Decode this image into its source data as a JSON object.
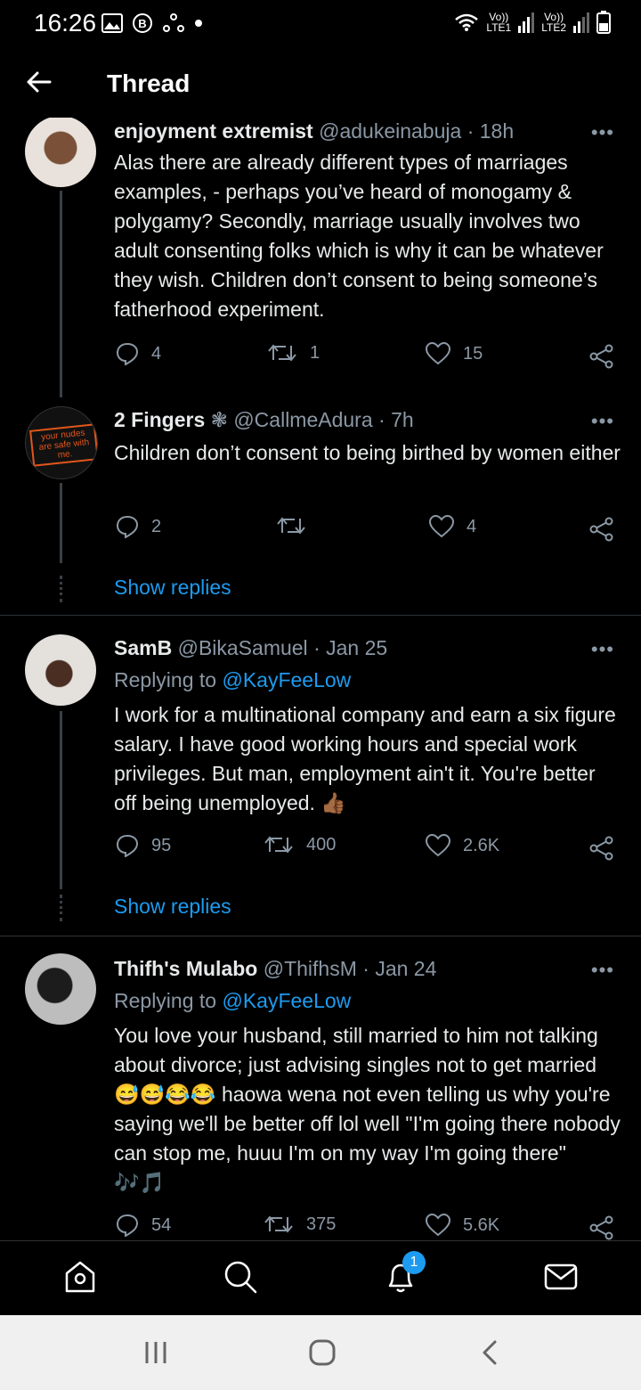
{
  "status": {
    "time": "16:26",
    "sim1": "LTE1",
    "sim2": "LTE2",
    "volte": "Vo))"
  },
  "header": {
    "title": "Thread"
  },
  "tweets": [
    {
      "name": "enjoyment extremist",
      "handle": "@adukeinabuja",
      "time": "· 18h",
      "text": "Alas there are already different types of marriages examples, - perhaps you’ve heard of monogamy & polygamy? Secondly, marriage usually involves two adult consenting folks which is why it can be whatever they wish. Children don’t  consent to being someone’s fatherhood experiment.",
      "replies": "4",
      "retweets": "1",
      "likes": "15"
    },
    {
      "name": "2 Fingers",
      "name_suffix": "❃",
      "handle": "@CallmeAdura",
      "time": "· 7h",
      "avatar_text": "your nudes are safe with me.",
      "text": "Children don’t consent to being birthed by women either",
      "replies": "2",
      "retweets": "",
      "likes": "4",
      "show_replies": "Show replies"
    },
    {
      "name": "SamB",
      "handle": "@BikaSamuel",
      "time": "· Jan 25",
      "replying_label": "Replying to",
      "replying_to": "@KayFeeLow",
      "text": "I work for a multinational company and earn a six figure salary. I have good working hours and special work privileges. But man, employment ain't it. You're better off being unemployed. 👍🏾",
      "replies": "95",
      "retweets": "400",
      "likes": "2.6K",
      "show_replies": "Show replies"
    },
    {
      "name": "Thifh's Mulabo",
      "handle": "@ThifhsM",
      "time": "· Jan 24",
      "replying_label": "Replying to",
      "replying_to": "@KayFeeLow",
      "text": "You love your husband, still married to him not talking about divorce; just advising singles not to get married 😅😅😂😂 haowa wena not even telling us why you're saying we'll be better off lol well \"I'm going there nobody can stop me, huuu I'm on my way I'm going there\" 🎶🎵",
      "replies": "54",
      "retweets": "375",
      "likes": "5.6K"
    }
  ],
  "nav": {
    "notification_count": "1"
  },
  "colors": {
    "background": "#000000",
    "accent": "#1d9bf0",
    "muted": "#8b98a5",
    "text": "#e7e9ea"
  }
}
